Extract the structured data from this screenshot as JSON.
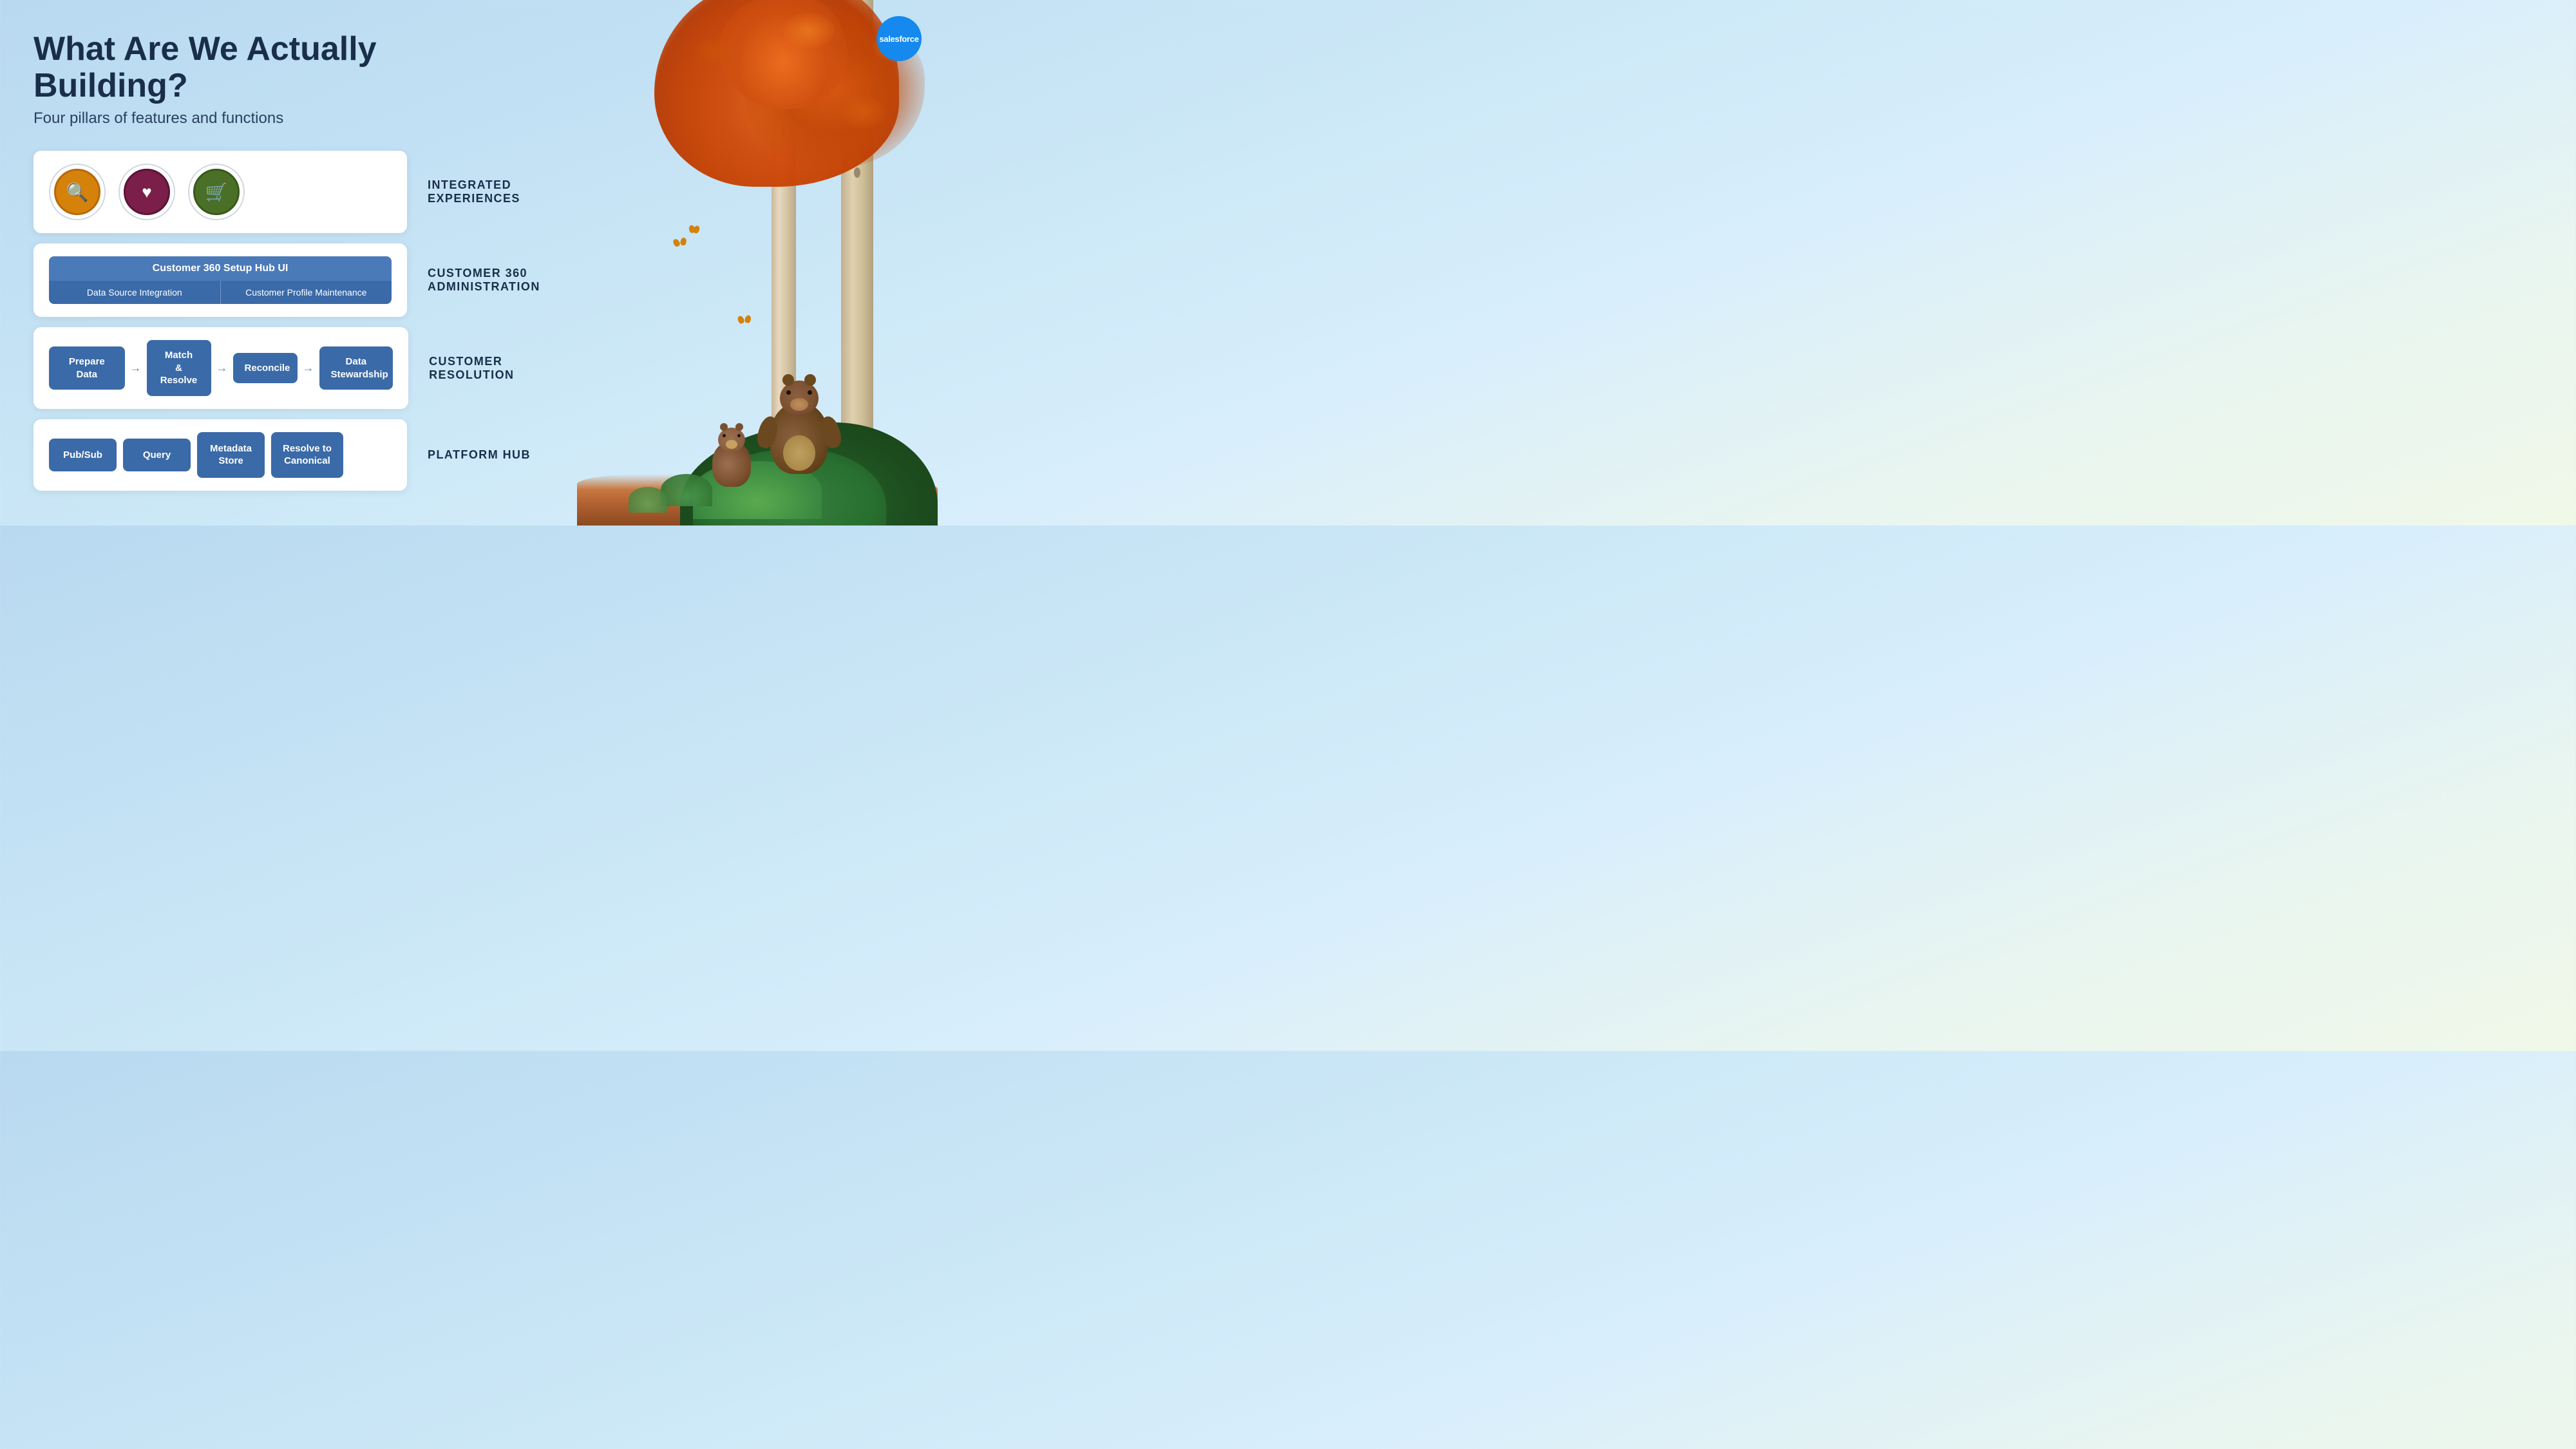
{
  "page": {
    "title": "What Are We Actually Building?",
    "subtitle": "Four pillars of features and functions"
  },
  "salesforce": {
    "logo_text": "salesforce"
  },
  "pillars": [
    {
      "id": "integrated-experiences",
      "label": "INTEGRATED EXPERIENCES",
      "icons": [
        {
          "name": "search",
          "symbol": "🔍",
          "color_class": "search-ic"
        },
        {
          "name": "heart",
          "symbol": "♡",
          "color_class": "heart-ic"
        },
        {
          "name": "cart",
          "symbol": "🛒",
          "color_class": "cart-ic"
        }
      ]
    },
    {
      "id": "customer-360-admin",
      "label": "CUSTOMER 360 ADMINISTRATION",
      "top_bar": "Customer 360 Setup Hub UI",
      "bottom_items": [
        "Data Source Integration",
        "Customer Profile Maintenance"
      ]
    },
    {
      "id": "customer-resolution",
      "label": "CUSTOMER RESOLUTION",
      "steps": [
        "Prepare Data",
        "Match\n& Resolve",
        "Reconcile",
        "Data\nStewardship"
      ]
    },
    {
      "id": "platform-hub",
      "label": "PLATFORM HUB",
      "steps": [
        "Pub/Sub",
        "Query",
        "Metadata\nStore",
        "Resolve to\nCanonical"
      ]
    }
  ],
  "icons": {
    "search_unicode": "🔍",
    "heart_unicode": "♥",
    "cart_unicode": "🛒",
    "arrow_unicode": "→"
  }
}
